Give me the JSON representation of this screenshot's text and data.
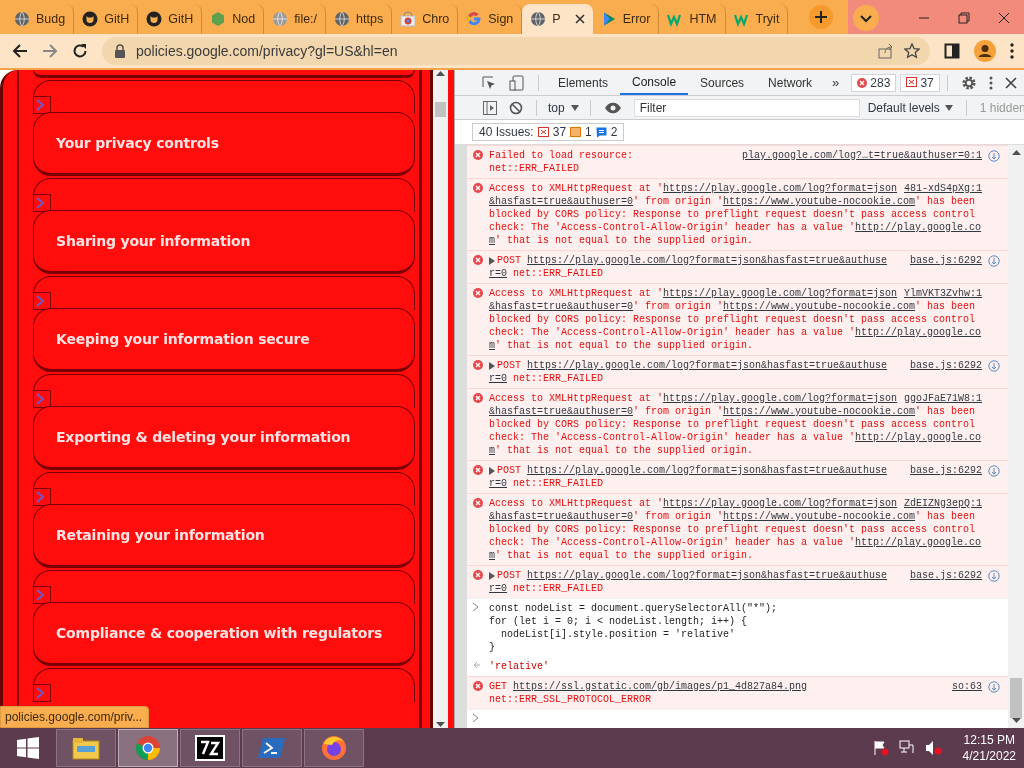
{
  "browser": {
    "tabs": [
      {
        "title": "Budg",
        "kind": "globe",
        "selected": false
      },
      {
        "title": "GitH",
        "kind": "github",
        "selected": false
      },
      {
        "title": "GitH",
        "kind": "github",
        "selected": false
      },
      {
        "title": "Nod",
        "kind": "node",
        "selected": false
      },
      {
        "title": "file:/",
        "kind": "file",
        "selected": false
      },
      {
        "title": "https",
        "kind": "globe",
        "selected": false
      },
      {
        "title": "Chro",
        "kind": "store",
        "selected": false
      },
      {
        "title": "Sign",
        "kind": "google",
        "selected": false
      },
      {
        "title": "P",
        "kind": "globe",
        "selected": true
      },
      {
        "title": "Error",
        "kind": "play",
        "selected": false
      },
      {
        "title": "HTM",
        "kind": "w3",
        "selected": false
      },
      {
        "title": "Tryit",
        "kind": "w3",
        "selected": false
      }
    ],
    "url": "policies.google.com/privacy?gl=US&hl=en",
    "status_url": "policies.google.com/priv..."
  },
  "page": {
    "sections": [
      "Your privacy controls",
      "Sharing your information",
      "Keeping your information secure",
      "Exporting & deleting your information",
      "Retaining your information",
      "Compliance & cooperation with regulators"
    ]
  },
  "devtools": {
    "tabs": [
      {
        "label": "Elements",
        "selected": false
      },
      {
        "label": "Console",
        "selected": true
      },
      {
        "label": "Sources",
        "selected": false
      },
      {
        "label": "Network",
        "selected": false
      }
    ],
    "more": "»",
    "error_count": "283",
    "issue_count": "37",
    "context": "top",
    "filter_placeholder": "Filter",
    "levels": "Default levels",
    "hidden": "1 hidden",
    "issues": {
      "label": "40 Issues:",
      "errors": "37",
      "warnings": "1",
      "info": "2"
    },
    "messages": [
      {
        "kind": "load-error",
        "source": "play.google.com/log?…t=true&authuser=0:1",
        "lines": [
          [
            {
              "kind": "text",
              "text": "Failed to load resource:"
            }
          ],
          [
            {
              "kind": "text",
              "text": "net::ERR_FAILED"
            }
          ]
        ]
      },
      {
        "kind": "error",
        "source": "481-xdS4pXg:1",
        "lines": [
          [
            {
              "kind": "text",
              "text": "Access to XMLHttpRequest at '"
            },
            {
              "kind": "link",
              "text": "https://play.google.com/log?format=json"
            }
          ],
          [
            {
              "kind": "link",
              "text": "&hasfast=true&authuser=0"
            },
            {
              "kind": "text",
              "text": "' from origin '"
            },
            {
              "kind": "link",
              "text": "https://www.youtube-nocookie.com"
            },
            {
              "kind": "text",
              "text": "' has been"
            }
          ],
          [
            {
              "kind": "text",
              "text": "blocked by CORS policy: Response to preflight request doesn't pass access control"
            }
          ],
          [
            {
              "kind": "text",
              "text": "check: The 'Access-Control-Allow-Origin' header has a value '"
            },
            {
              "kind": "link",
              "text": "http://play.google.co"
            }
          ],
          [
            {
              "kind": "link",
              "text": "m"
            },
            {
              "kind": "text",
              "text": "' that is not equal to the supplied origin."
            }
          ]
        ]
      },
      {
        "kind": "request",
        "source": "base.js:6292",
        "lines": [
          [
            {
              "kind": "text",
              "text": "POST "
            },
            {
              "kind": "link",
              "text": "https://play.google.com/log?format=json&hasfast=true&authuse"
            }
          ],
          [
            {
              "kind": "link",
              "text": "r=0"
            },
            {
              "kind": "text",
              "text": " net::ERR_FAILED"
            }
          ]
        ]
      },
      {
        "kind": "error",
        "source": "YlmVKT3Zvhw:1",
        "lines": [
          [
            {
              "kind": "text",
              "text": "Access to XMLHttpRequest at '"
            },
            {
              "kind": "link",
              "text": "https://play.google.com/log?format=json"
            }
          ],
          [
            {
              "kind": "link",
              "text": "&hasfast=true&authuser=0"
            },
            {
              "kind": "text",
              "text": "' from origin '"
            },
            {
              "kind": "link",
              "text": "https://www.youtube-nocookie.com"
            },
            {
              "kind": "text",
              "text": "' has been"
            }
          ],
          [
            {
              "kind": "text",
              "text": "blocked by CORS policy: Response to preflight request doesn't pass access control"
            }
          ],
          [
            {
              "kind": "text",
              "text": "check: The 'Access-Control-Allow-Origin' header has a value '"
            },
            {
              "kind": "link",
              "text": "http://play.google.co"
            }
          ],
          [
            {
              "kind": "link",
              "text": "m"
            },
            {
              "kind": "text",
              "text": "' that is not equal to the supplied origin."
            }
          ]
        ]
      },
      {
        "kind": "request",
        "source": "base.js:6292",
        "lines": [
          [
            {
              "kind": "text",
              "text": "POST "
            },
            {
              "kind": "link",
              "text": "https://play.google.com/log?format=json&hasfast=true&authuse"
            }
          ],
          [
            {
              "kind": "link",
              "text": "r=0"
            },
            {
              "kind": "text",
              "text": " net::ERR_FAILED"
            }
          ]
        ]
      },
      {
        "kind": "error",
        "source": "ggoJFaE71W8:1",
        "lines": [
          [
            {
              "kind": "text",
              "text": "Access to XMLHttpRequest at '"
            },
            {
              "kind": "link",
              "text": "https://play.google.com/log?format=json"
            }
          ],
          [
            {
              "kind": "link",
              "text": "&hasfast=true&authuser=0"
            },
            {
              "kind": "text",
              "text": "' from origin '"
            },
            {
              "kind": "link",
              "text": "https://www.youtube-nocookie.com"
            },
            {
              "kind": "text",
              "text": "' has been"
            }
          ],
          [
            {
              "kind": "text",
              "text": "blocked by CORS policy: Response to preflight request doesn't pass access control"
            }
          ],
          [
            {
              "kind": "text",
              "text": "check: The 'Access-Control-Allow-Origin' header has a value '"
            },
            {
              "kind": "link",
              "text": "http://play.google.co"
            }
          ],
          [
            {
              "kind": "link",
              "text": "m"
            },
            {
              "kind": "text",
              "text": "' that is not equal to the supplied origin."
            }
          ]
        ]
      },
      {
        "kind": "request",
        "source": "base.js:6292",
        "lines": [
          [
            {
              "kind": "text",
              "text": "POST "
            },
            {
              "kind": "link",
              "text": "https://play.google.com/log?format=json&hasfast=true&authuse"
            }
          ],
          [
            {
              "kind": "link",
              "text": "r=0"
            },
            {
              "kind": "text",
              "text": " net::ERR_FAILED"
            }
          ]
        ]
      },
      {
        "kind": "error",
        "source": "ZdEIZNg3epQ:1",
        "lines": [
          [
            {
              "kind": "text",
              "text": "Access to XMLHttpRequest at '"
            },
            {
              "kind": "link",
              "text": "https://play.google.com/log?format=json"
            }
          ],
          [
            {
              "kind": "link",
              "text": "&hasfast=true&authuser=0"
            },
            {
              "kind": "text",
              "text": "' from origin '"
            },
            {
              "kind": "link",
              "text": "https://www.youtube-nocookie.com"
            },
            {
              "kind": "text",
              "text": "' has been"
            }
          ],
          [
            {
              "kind": "text",
              "text": "blocked by CORS policy: Response to preflight request doesn't pass access control"
            }
          ],
          [
            {
              "kind": "text",
              "text": "check: The 'Access-Control-Allow-Origin' header has a value '"
            },
            {
              "kind": "link",
              "text": "http://play.google.co"
            }
          ],
          [
            {
              "kind": "link",
              "text": "m"
            },
            {
              "kind": "text",
              "text": "' that is not equal to the supplied origin."
            }
          ]
        ]
      },
      {
        "kind": "request",
        "source": "base.js:6292",
        "lines": [
          [
            {
              "kind": "text",
              "text": "POST "
            },
            {
              "kind": "link",
              "text": "https://play.google.com/log?format=json&hasfast=true&authuse"
            }
          ],
          [
            {
              "kind": "link",
              "text": "r=0"
            },
            {
              "kind": "text",
              "text": " net::ERR_FAILED"
            }
          ]
        ]
      },
      {
        "kind": "input",
        "code": "const nodeList = document.querySelectorAll(\"*\");\nfor (let i = 0; i < nodeList.length; i++) {\n  nodeList[i].style.position = 'relative'\n}"
      },
      {
        "kind": "result",
        "code": "'relative'"
      },
      {
        "kind": "load-error",
        "source": "so:63",
        "lines": [
          [
            {
              "kind": "text",
              "text": "GET "
            },
            {
              "kind": "link",
              "text": "https://ssl.gstatic.com/gb/images/p1_4d827a84.png"
            }
          ],
          [
            {
              "kind": "text",
              "text": "net::ERR_SSL_PROTOCOL_ERROR"
            }
          ]
        ]
      },
      {
        "kind": "prompt"
      }
    ]
  },
  "taskbar": {
    "apps": [
      {
        "kind": "explorer",
        "selected": false
      },
      {
        "kind": "chrome",
        "selected": true
      },
      {
        "kind": "archiver",
        "selected": false
      },
      {
        "kind": "shell",
        "selected": false
      },
      {
        "kind": "firefox",
        "selected": false
      }
    ],
    "time": "12:15 PM",
    "date": "4/21/2022"
  }
}
